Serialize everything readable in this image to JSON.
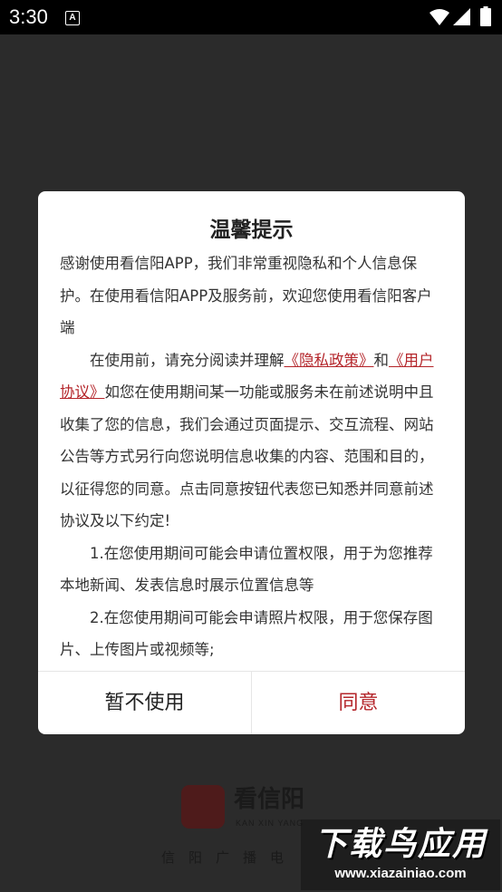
{
  "status_bar": {
    "time": "3:30",
    "notification_icon_letter": "A",
    "icons": [
      "a-notification-icon",
      "wifi-icon",
      "signal-icon",
      "battery-icon"
    ]
  },
  "splash": {
    "app_name": "看信阳",
    "app_pinyin": "KAN XIN YANG",
    "slogan": "信阳广播电",
    "logo_color": "#4e1b1b"
  },
  "dialog": {
    "title": "温馨提示",
    "para1": "感谢使用看信阳APP，我们非常重视隐私和个人信息保护。在使用看信阳APP及服务前，欢迎您使用看信阳客户端",
    "para2_lead": "在使用前，请充分阅读并理解",
    "privacy_link": "《隐私政策》",
    "para2_and": "和",
    "user_agreement_link": "《用户协议》",
    "para2_rest": "如您在使用期间某一功能或服务未在前述说明中且收集了您的信息，我们会通过页面提示、交互流程、网站公告等方式另行向您说明信息收集的内容、范围和目的，以征得您的同意。点击同意按钮代表您已知悉并同意前述协议及以下约定!",
    "item1": "1.在您使用期间可能会申请位置权限，用于为您推荐本地新闻、发表信息时展示位置信息等",
    "item2": "2.在您使用期间可能会申请照片权限，用于您保存图片、上传图片或视频等;",
    "decline_button": "暂不使用",
    "agree_button": "同意"
  },
  "watermark": {
    "title": "下载鸟应用",
    "url": "www.xiazainiao.com"
  },
  "colors": {
    "accent": "#b4252a",
    "overlay": "#2b2b2b",
    "status_bar": "#000000"
  }
}
